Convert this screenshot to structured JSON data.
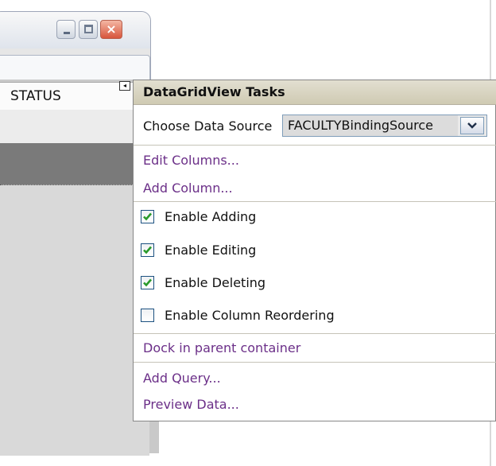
{
  "grid": {
    "column_header": "STATUS"
  },
  "panel": {
    "title": "DataGridView Tasks",
    "choose_data_source_label": "Choose Data Source",
    "data_source_value": "FACULTYBindingSource",
    "links": {
      "edit_columns": "Edit Columns...",
      "add_column": "Add Column...",
      "dock": "Dock in parent container",
      "add_query": "Add Query...",
      "preview_data": "Preview Data..."
    },
    "options": [
      {
        "label": "Enable Adding",
        "checked": true
      },
      {
        "label": "Enable Editing",
        "checked": true
      },
      {
        "label": "Enable Deleting",
        "checked": true
      },
      {
        "label": "Enable Column Reordering",
        "checked": false
      }
    ]
  },
  "window": {
    "close_glyph": "×"
  },
  "colors": {
    "link": "#6b2f88",
    "title_bar": "#d8d4c2",
    "check_green": "#2a9a2a"
  }
}
